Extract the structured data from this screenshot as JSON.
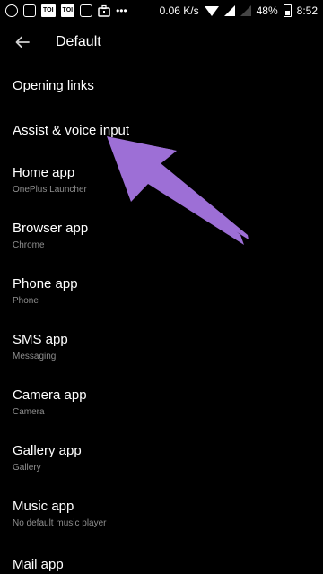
{
  "status_bar": {
    "box1": "TOI",
    "box2": "TOI",
    "overflow": "•••",
    "net_speed": "0.06 K/s",
    "battery": "48%",
    "time": "8:52",
    "icons": [
      "whatsapp-icon",
      "instagram-icon",
      "toi-icon",
      "toi-icon",
      "gallery-icon",
      "briefcase-icon",
      "wifi-icon",
      "signal-icon",
      "battery-icon"
    ]
  },
  "header": {
    "title": "Default",
    "back_icon": "arrow-back-icon"
  },
  "items": [
    {
      "title": "Opening links"
    },
    {
      "title": "Assist & voice input"
    },
    {
      "title": "Home app",
      "subtitle": "OnePlus Launcher"
    },
    {
      "title": "Browser app",
      "subtitle": "Chrome"
    },
    {
      "title": "Phone app",
      "subtitle": "Phone"
    },
    {
      "title": "SMS app",
      "subtitle": "Messaging"
    },
    {
      "title": "Camera app",
      "subtitle": "Camera"
    },
    {
      "title": "Gallery app",
      "subtitle": "Gallery"
    },
    {
      "title": "Music app",
      "subtitle": "No default music player"
    },
    {
      "title": "Mail app"
    }
  ],
  "colors": {
    "background": "#000000",
    "text_primary": "#ffffff",
    "text_secondary": "#8e8e8e",
    "annotation_arrow": "#9d6fd6"
  }
}
